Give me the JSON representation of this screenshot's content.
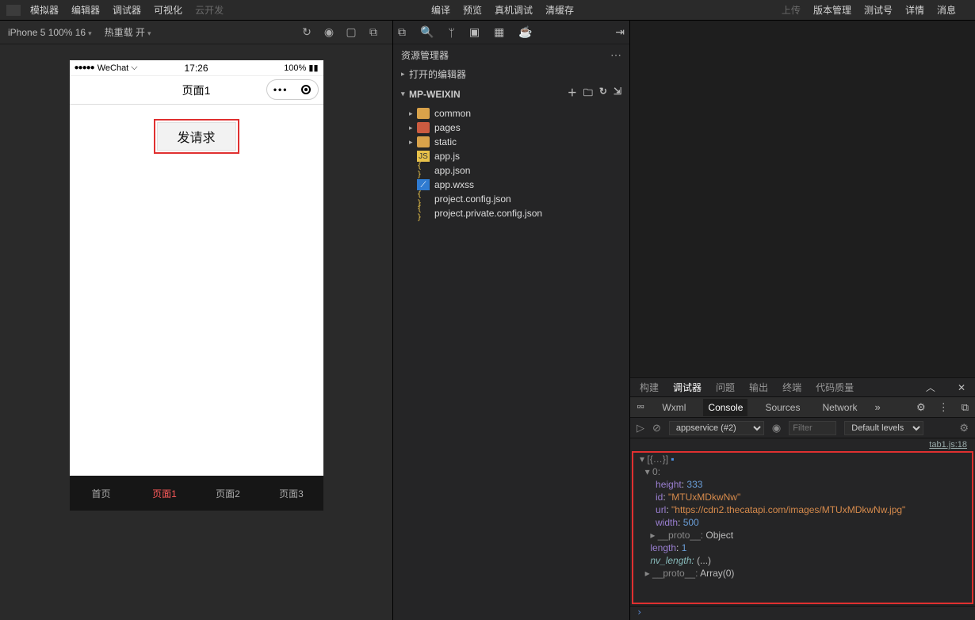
{
  "menu": {
    "items": [
      "模拟器",
      "编辑器",
      "调试器",
      "可视化"
    ],
    "disabled": "云开发",
    "center": [
      "编译",
      "预览",
      "真机调试",
      "清缓存"
    ],
    "right": [
      "上传",
      "版本管理",
      "测试号",
      "详情",
      "消息"
    ]
  },
  "sim": {
    "device": "iPhone 5 100% 16",
    "hot": "热重载 开",
    "status_carrier": "WeChat",
    "status_time": "17:26",
    "status_batt": "100%",
    "nav_title": "页面1",
    "button_label": "发请求",
    "tabs": [
      "首页",
      "页面1",
      "页面2",
      "页面3"
    ],
    "active_tab": 1
  },
  "explorer": {
    "title": "资源管理器",
    "opened": "打开的编辑器",
    "project": "MP-WEIXIN",
    "folders": [
      "common",
      "pages",
      "static"
    ],
    "files": [
      "app.js",
      "app.json",
      "app.wxss",
      "project.config.json",
      "project.private.config.json"
    ]
  },
  "devtools": {
    "row1": [
      "构建",
      "调试器",
      "问题",
      "输出",
      "终端",
      "代码质量"
    ],
    "row1_active": 1,
    "row2": [
      "Wxml",
      "Console",
      "Sources",
      "Network"
    ],
    "row2_active": 1,
    "context": "appservice (#2)",
    "filter_ph": "Filter",
    "levels": "Default levels",
    "source": "tab1.js:18",
    "log": {
      "arrhead": "▾ [{…}]",
      "idx": "▾ 0:",
      "height_k": "height",
      "height_v": "333",
      "id_k": "id",
      "id_v": "\"MTUxMDkwNw\"",
      "url_k": "url",
      "url_v": "\"https://cdn2.thecatapi.com/images/MTUxMDkwNw.jpg\"",
      "width_k": "width",
      "width_v": "500",
      "proto1": "▸ __proto__: ",
      "proto1_v": "Object",
      "length_k": "length",
      "length_v": "1",
      "nvlen": "nv_length: ",
      "nvlen_v": "(...)",
      "proto2": "▸ __proto__: ",
      "proto2_v": "Array(0)"
    }
  }
}
